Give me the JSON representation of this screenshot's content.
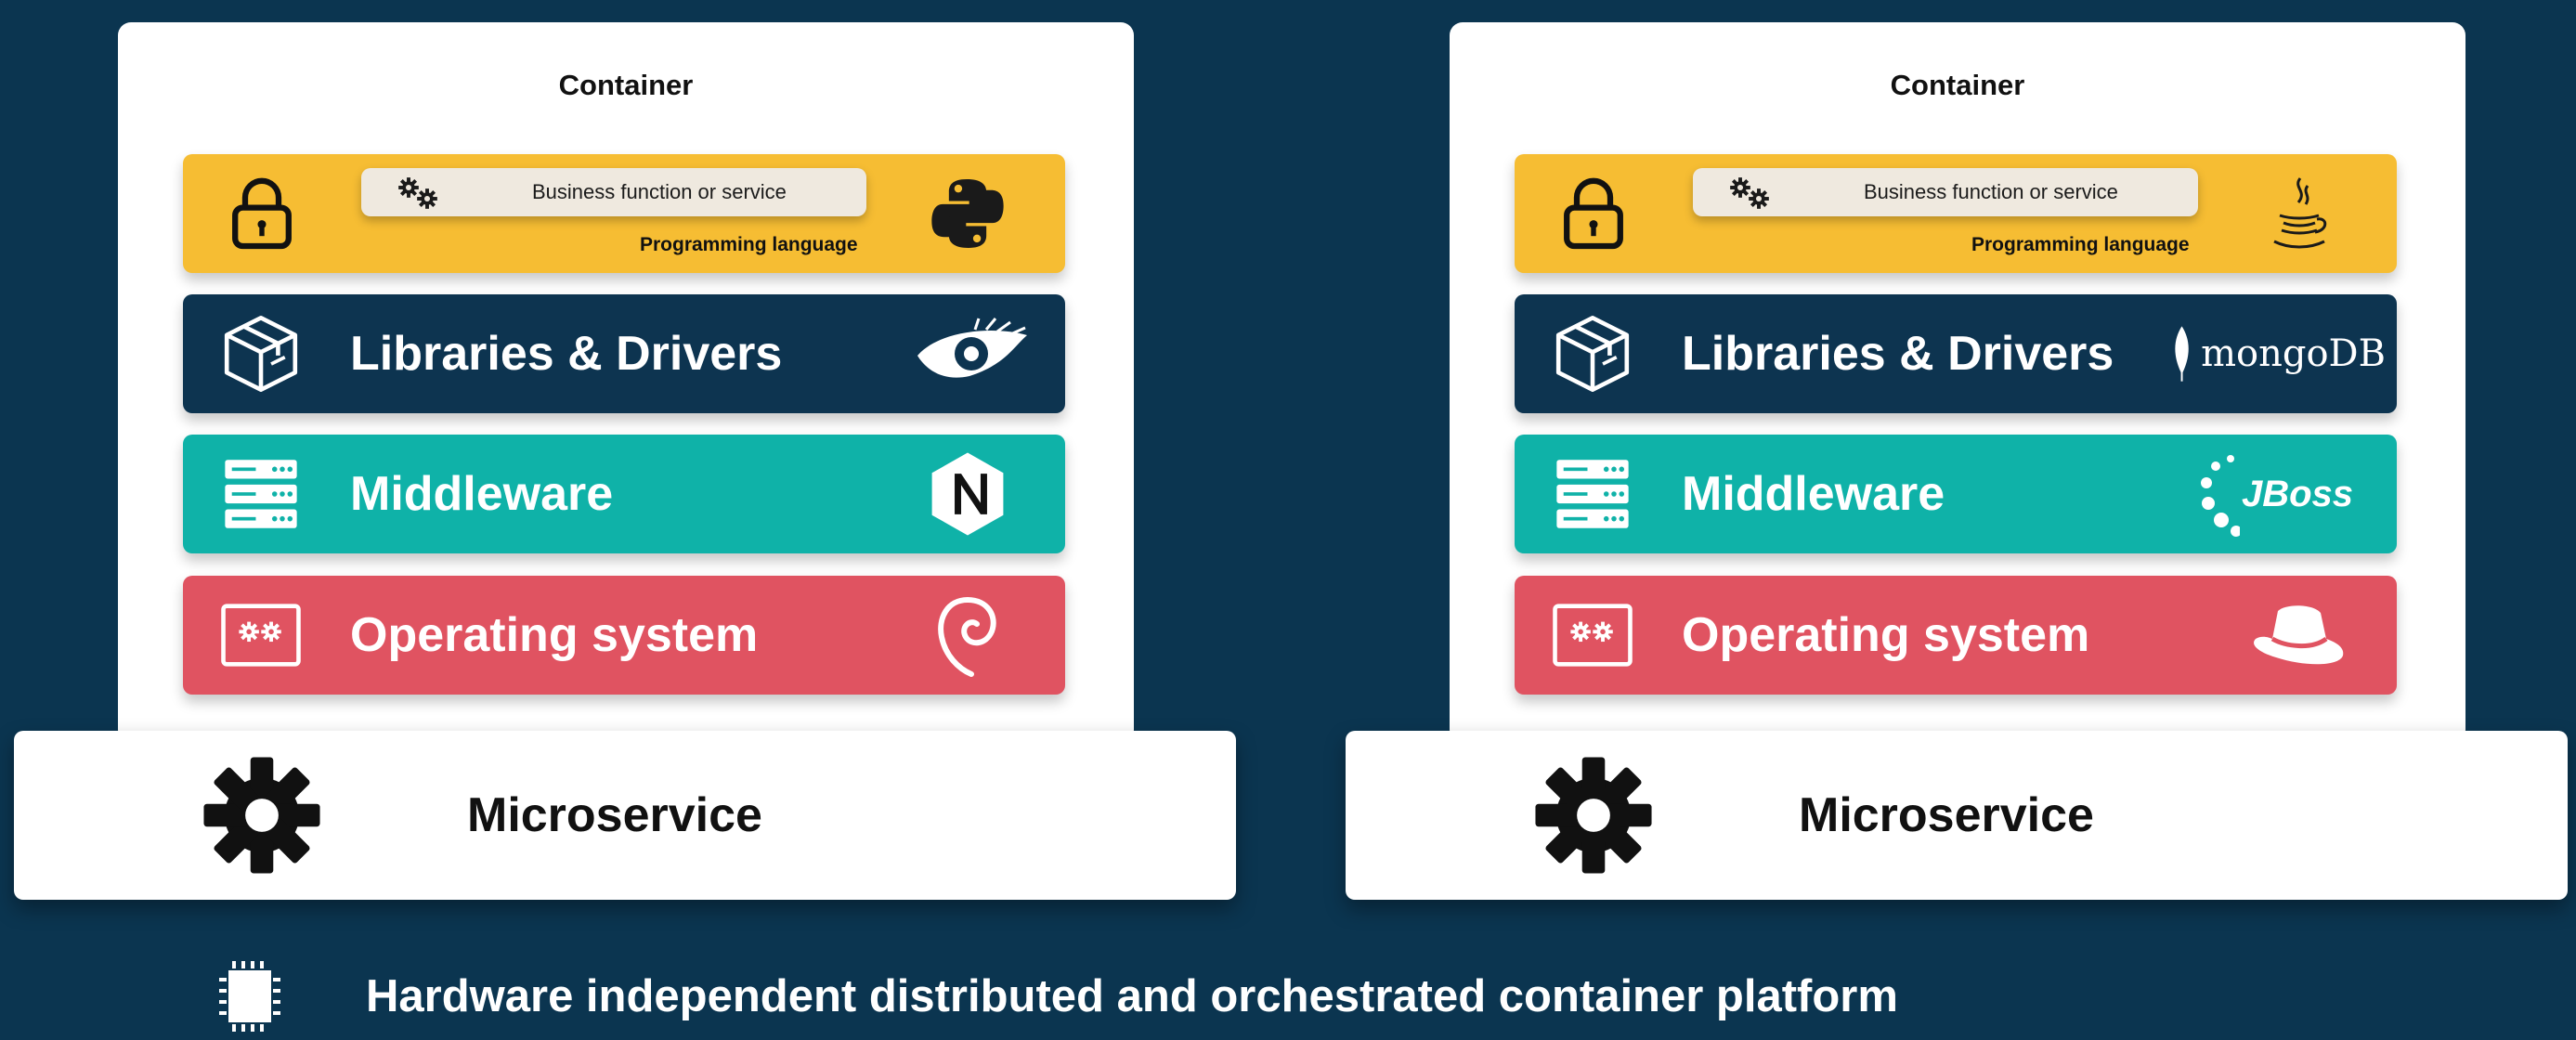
{
  "stacks": [
    {
      "container_title": "Container",
      "business_label": "Business function or service",
      "programming_label": "Programming language",
      "layer_libraries": "Libraries & Drivers",
      "layer_middleware": "Middleware",
      "layer_os": "Operating system",
      "microservice_label": "Microservice",
      "logos": {
        "language": "python-logo",
        "libraries": "cassandra-logo",
        "middleware": "nginx-logo",
        "os": "debian-logo"
      }
    },
    {
      "container_title": "Container",
      "business_label": "Business function or service",
      "programming_label": "Programming language",
      "layer_libraries": "Libraries & Drivers",
      "layer_middleware": "Middleware",
      "layer_os": "Operating system",
      "microservice_label": "Microservice",
      "mongo_text": "mongoDB",
      "jboss_text": "JBoss",
      "logos": {
        "language": "java-logo",
        "libraries": "mongodb-logo",
        "middleware": "jboss-logo",
        "os": "redhat-logo"
      }
    }
  ],
  "platform_label": "Hardware independent distributed and orchestrated container platform",
  "colors": {
    "background": "#0b3550",
    "language_layer": "#f6bd33",
    "libraries_layer": "#0d3450",
    "middleware_layer": "#0fb2a8",
    "os_layer": "#e05361"
  }
}
